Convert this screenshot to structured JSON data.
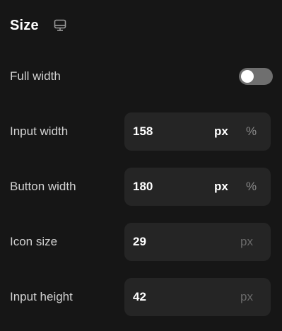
{
  "section": {
    "title": "Size",
    "device_icon": "desktop-monitor-icon"
  },
  "full_width": {
    "label": "Full width",
    "enabled": false
  },
  "input_width": {
    "label": "Input width",
    "value": "158",
    "unit_primary": "px",
    "unit_secondary": "%"
  },
  "button_width": {
    "label": "Button width",
    "value": "180",
    "unit_primary": "px",
    "unit_secondary": "%"
  },
  "icon_size": {
    "label": "Icon size",
    "value": "29",
    "unit": "px"
  },
  "input_height": {
    "label": "Input height",
    "value": "42",
    "unit": "px"
  },
  "colors": {
    "background": "#161616",
    "field": "#252525",
    "toggle_off": "#6f6f6f",
    "text": "#ffffff",
    "label": "#d2d2d2"
  }
}
